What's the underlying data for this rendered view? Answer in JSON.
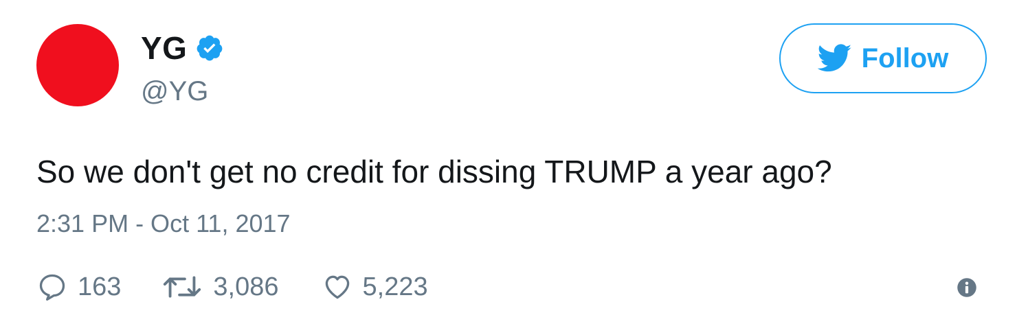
{
  "colors": {
    "avatar": "#f00f1e",
    "accent": "#1da1f2",
    "text": "#14171a",
    "muted": "#657786"
  },
  "user": {
    "display_name": "YG",
    "handle": "@YG",
    "verified_icon": "verified-badge-icon"
  },
  "follow_button": {
    "label": "Follow",
    "icon": "twitter-bird-icon"
  },
  "tweet": {
    "text": "So we don't get no credit for dissing TRUMP a year ago?",
    "timestamp": "2:31 PM - Oct 11, 2017"
  },
  "actions": {
    "replies": {
      "icon": "reply-icon",
      "count": "163"
    },
    "retweets": {
      "icon": "retweet-icon",
      "count": "3,086"
    },
    "likes": {
      "icon": "heart-icon",
      "count": "5,223"
    },
    "info_icon": "info-icon"
  }
}
